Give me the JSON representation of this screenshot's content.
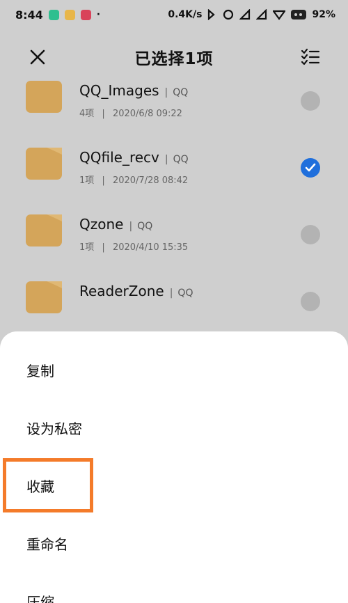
{
  "status_bar": {
    "time": "8:44",
    "dot": "·",
    "net_speed": "0.4K/s",
    "battery": "92%"
  },
  "header": {
    "title": "已选择1项"
  },
  "files": [
    {
      "name": "QQ_Images",
      "source": "QQ",
      "count": "4项",
      "date": "2020/6/8 09:22",
      "selected": false
    },
    {
      "name": "QQfile_recv",
      "source": "QQ",
      "count": "1项",
      "date": "2020/7/28 08:42",
      "selected": true
    },
    {
      "name": "Qzone",
      "source": "QQ",
      "count": "1项",
      "date": "2020/4/10 15:35",
      "selected": false
    },
    {
      "name": "ReaderZone",
      "source": "QQ",
      "count": "",
      "date": "",
      "selected": false
    }
  ],
  "separator": "|",
  "menu": {
    "copy": "复制",
    "set_private": "设为私密",
    "favorite": "收藏",
    "rename": "重命名",
    "compress": "压缩"
  },
  "colors": {
    "folder": "#d4a55a",
    "check_on": "#1f6fdc",
    "highlight": "#f47b2a"
  }
}
